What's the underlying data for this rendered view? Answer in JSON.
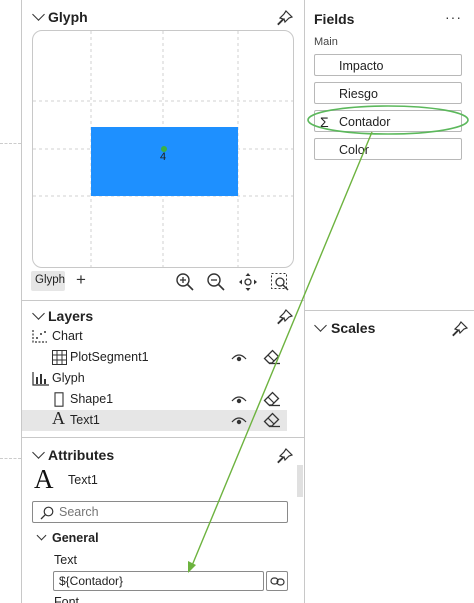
{
  "glyph_panel": {
    "title": "Glyph",
    "tab_label": "Glyph",
    "add_label": "+",
    "text_mark": "4"
  },
  "fields_panel": {
    "title": "Fields",
    "more_label": "···",
    "section": "Main",
    "items": [
      {
        "label": "Impacto",
        "icon": ""
      },
      {
        "label": "Riesgo",
        "icon": ""
      },
      {
        "label": "Contador",
        "icon": "Σ"
      },
      {
        "label": "Color",
        "icon": ""
      }
    ]
  },
  "scales_panel": {
    "title": "Scales"
  },
  "layers_panel": {
    "title": "Layers",
    "items": [
      {
        "label": "Chart",
        "icon": "chart-icon"
      },
      {
        "label": "PlotSegment1",
        "icon": "grid-icon"
      },
      {
        "label": "Glyph",
        "icon": "glyph-icon"
      },
      {
        "label": "Shape1",
        "icon": "rectangle-icon"
      },
      {
        "label": "Text1",
        "icon": "text-icon"
      }
    ]
  },
  "attributes_panel": {
    "title": "Attributes",
    "element_glyph": "A",
    "element_name": "Text1",
    "search_placeholder": "Search",
    "section_general": "General",
    "text_label": "Text",
    "text_value": "${Contador}",
    "next_label": "Font"
  },
  "colors": {
    "accent": "#1e90ff",
    "highlight_oval": "#5cb85c",
    "arrow": "#6db33f",
    "selected_row": "#e6e6e6"
  }
}
